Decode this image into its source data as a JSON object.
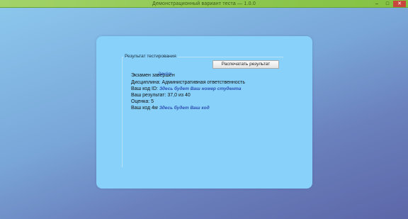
{
  "window": {
    "title": "Демонстрационный вариант теста — 1.0.0",
    "controls": {
      "minimize": "–",
      "maximize": "□",
      "close": "✕"
    }
  },
  "result": {
    "group_title": "Результат тестирования",
    "save_button": "Распечатать результат",
    "exam_line": "Экзамен завершён",
    "exam_overlap": "Зачёт",
    "discipline_line": "Дисциплина: Административная ответственность",
    "id_label": "Ваш код ID:",
    "id_value": "Здесь будет Ваш номер студента",
    "score_line": "Ваш результат: 37,0 из 40",
    "grade_line": "Оценка: 5",
    "code_label": "Ваш код 4м",
    "code_value": "Здесь будет Ваш код"
  },
  "colors": {
    "titlebar": "#8dc74e",
    "panel": "#87d1fa",
    "value_text": "#2e4fb3",
    "close_button": "#c9463d"
  }
}
